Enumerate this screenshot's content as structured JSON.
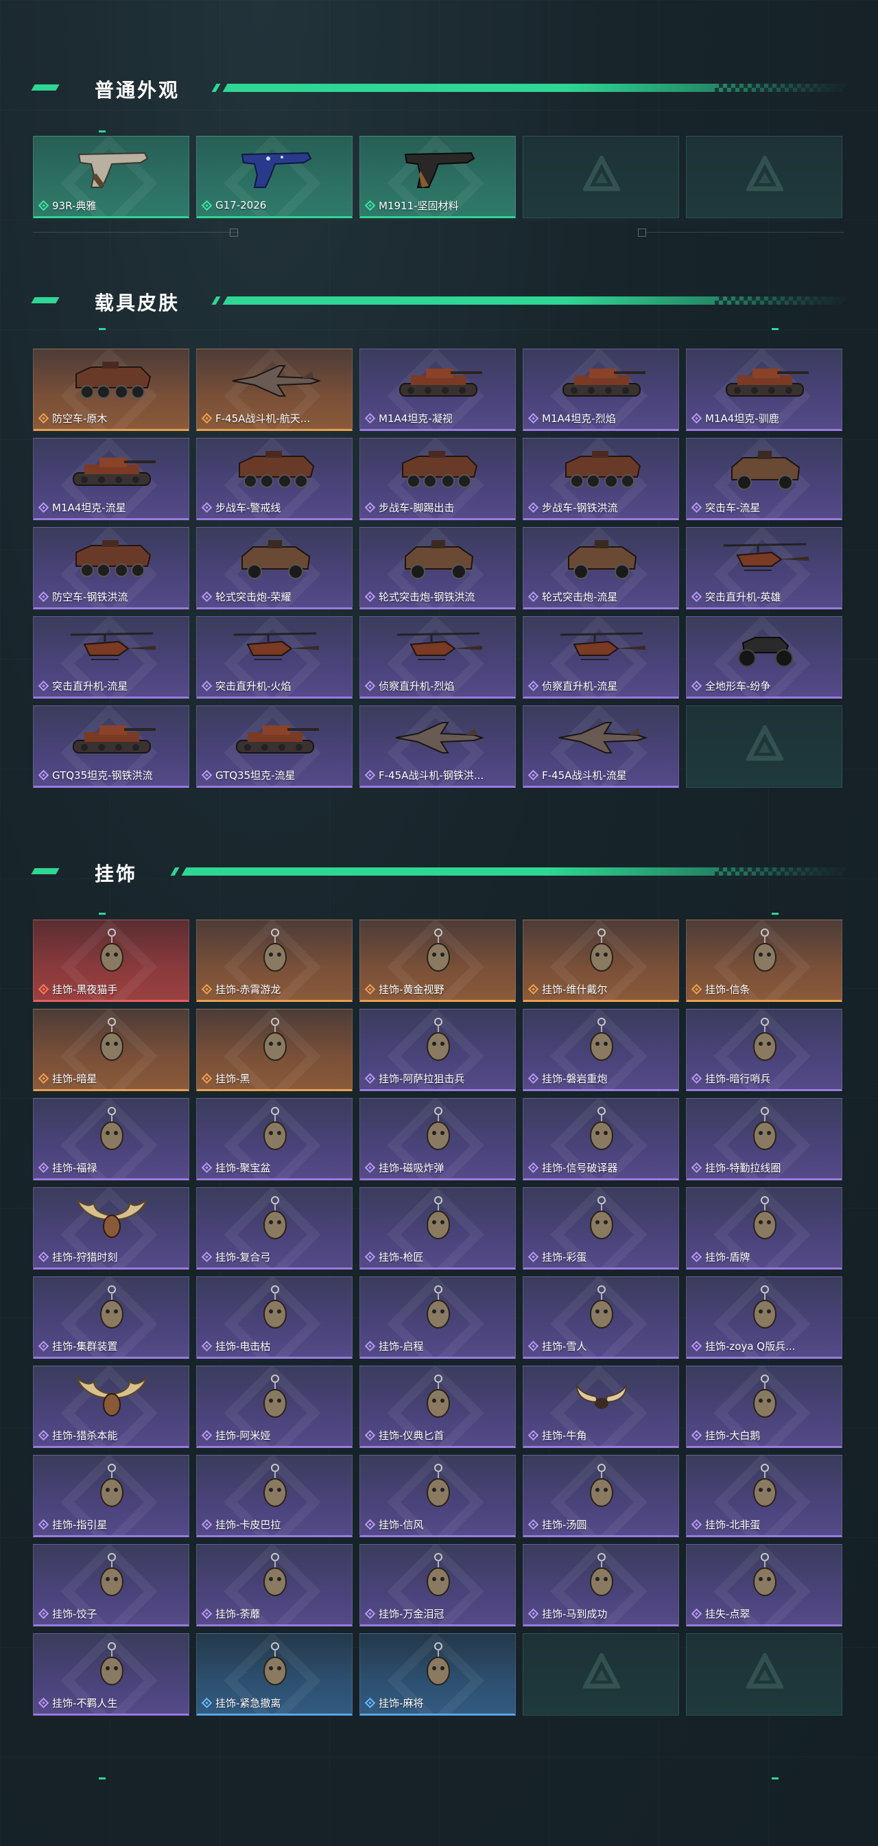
{
  "sections": [
    {
      "title": "普通外观",
      "cards": [
        {
          "name": "93R-典雅",
          "rarity": "green",
          "icon": "pistol"
        },
        {
          "name": "G17-2026",
          "rarity": "green",
          "icon": "pistol-blue"
        },
        {
          "name": "M1911-坚固材料",
          "rarity": "green",
          "icon": "pistol-dark"
        },
        {
          "name": "",
          "rarity": "empty",
          "icon": ""
        },
        {
          "name": "",
          "rarity": "empty",
          "icon": ""
        }
      ]
    },
    {
      "title": "载具皮肤",
      "cards": [
        {
          "name": "防空车-原木",
          "rarity": "orange",
          "icon": "wheeled-vehicle"
        },
        {
          "name": "F-45A战斗机-航天...",
          "rarity": "orange",
          "icon": "jet"
        },
        {
          "name": "M1A4坦克-凝视",
          "rarity": "purple",
          "icon": "tank"
        },
        {
          "name": "M1A4坦克-烈焰",
          "rarity": "purple",
          "icon": "tank"
        },
        {
          "name": "M1A4坦克-驯鹿",
          "rarity": "purple",
          "icon": "tank"
        },
        {
          "name": "M1A4坦克-流星",
          "rarity": "purple",
          "icon": "tank"
        },
        {
          "name": "步战车-警戒线",
          "rarity": "purple",
          "icon": "wheeled-vehicle"
        },
        {
          "name": "步战车-脚踢出击",
          "rarity": "purple",
          "icon": "wheeled-vehicle"
        },
        {
          "name": "步战车-钢铁洪流",
          "rarity": "purple",
          "icon": "wheeled-vehicle"
        },
        {
          "name": "突击车-流星",
          "rarity": "purple",
          "icon": "truck"
        },
        {
          "name": "防空车-钢铁洪流",
          "rarity": "purple",
          "icon": "wheeled-vehicle"
        },
        {
          "name": "轮式突击炮-荣耀",
          "rarity": "purple",
          "icon": "truck"
        },
        {
          "name": "轮式突击炮-钢铁洪流",
          "rarity": "purple",
          "icon": "truck"
        },
        {
          "name": "轮式突击炮-流星",
          "rarity": "purple",
          "icon": "truck"
        },
        {
          "name": "突击直升机-英雄",
          "rarity": "purple",
          "icon": "helicopter"
        },
        {
          "name": "突击直升机-流星",
          "rarity": "purple",
          "icon": "helicopter"
        },
        {
          "name": "突击直升机-火焰",
          "rarity": "purple",
          "icon": "helicopter"
        },
        {
          "name": "侦察直升机-烈焰",
          "rarity": "purple",
          "icon": "helicopter"
        },
        {
          "name": "侦察直升机-流星",
          "rarity": "purple",
          "icon": "helicopter"
        },
        {
          "name": "全地形车-纷争",
          "rarity": "purple",
          "icon": "atv"
        },
        {
          "name": "GTQ35坦克-钢铁洪流",
          "rarity": "purple",
          "icon": "tank"
        },
        {
          "name": "GTQ35坦克-流星",
          "rarity": "purple",
          "icon": "tank"
        },
        {
          "name": "F-45A战斗机-钢铁洪...",
          "rarity": "purple",
          "icon": "jet"
        },
        {
          "name": "F-45A战斗机-流星",
          "rarity": "purple",
          "icon": "jet"
        },
        {
          "name": "",
          "rarity": "empty",
          "icon": ""
        }
      ]
    },
    {
      "title": "挂饰",
      "cards": [
        {
          "name": "挂饰-黑夜猫手",
          "rarity": "red",
          "icon": "charm"
        },
        {
          "name": "挂饰-赤霄游龙",
          "rarity": "orange",
          "icon": "charm"
        },
        {
          "name": "挂饰-黄金视野",
          "rarity": "orange",
          "icon": "charm"
        },
        {
          "name": "挂饰-维什戴尔",
          "rarity": "orange",
          "icon": "charm"
        },
        {
          "name": "挂饰-信条",
          "rarity": "orange",
          "icon": "charm"
        },
        {
          "name": "挂饰-暗星",
          "rarity": "orange",
          "icon": "charm"
        },
        {
          "name": "挂饰-黑",
          "rarity": "orange",
          "icon": "charm"
        },
        {
          "name": "挂饰-阿萨拉狙击兵",
          "rarity": "purple",
          "icon": "charm"
        },
        {
          "name": "挂饰-磐岩重炮",
          "rarity": "purple",
          "icon": "charm"
        },
        {
          "name": "挂饰-暗行哨兵",
          "rarity": "purple",
          "icon": "charm"
        },
        {
          "name": "挂饰-福禄",
          "rarity": "purple",
          "icon": "charm"
        },
        {
          "name": "挂饰-聚宝盆",
          "rarity": "purple",
          "icon": "charm"
        },
        {
          "name": "挂饰-磁吸炸弹",
          "rarity": "purple",
          "icon": "charm"
        },
        {
          "name": "挂饰-信号破译器",
          "rarity": "purple",
          "icon": "charm"
        },
        {
          "name": "挂饰-特勤拉线圈",
          "rarity": "purple",
          "icon": "charm"
        },
        {
          "name": "挂饰-狩猎时刻",
          "rarity": "purple",
          "icon": "charm-antlers"
        },
        {
          "name": "挂饰-复合弓",
          "rarity": "purple",
          "icon": "charm"
        },
        {
          "name": "挂饰-枪匠",
          "rarity": "purple",
          "icon": "charm"
        },
        {
          "name": "挂饰-彩蛋",
          "rarity": "purple",
          "icon": "charm"
        },
        {
          "name": "挂饰-盾牌",
          "rarity": "purple",
          "icon": "charm"
        },
        {
          "name": "挂饰-集群装置",
          "rarity": "purple",
          "icon": "charm"
        },
        {
          "name": "挂饰-电击枯",
          "rarity": "purple",
          "icon": "charm"
        },
        {
          "name": "挂饰-启程",
          "rarity": "purple",
          "icon": "charm"
        },
        {
          "name": "挂饰-雪人",
          "rarity": "purple",
          "icon": "charm"
        },
        {
          "name": "挂饰-zoya Q版兵...",
          "rarity": "purple",
          "icon": "charm"
        },
        {
          "name": "挂饰-猎杀本能",
          "rarity": "purple",
          "icon": "charm-antlers"
        },
        {
          "name": "挂饰-阿米娅",
          "rarity": "purple",
          "icon": "charm"
        },
        {
          "name": "挂饰-仪典匕首",
          "rarity": "purple",
          "icon": "charm"
        },
        {
          "name": "挂饰-牛角",
          "rarity": "purple",
          "icon": "charm-horns"
        },
        {
          "name": "挂饰-大白鹅",
          "rarity": "purple",
          "icon": "charm"
        },
        {
          "name": "挂饰-指引星",
          "rarity": "purple",
          "icon": "charm"
        },
        {
          "name": "挂饰-卡皮巴拉",
          "rarity": "purple",
          "icon": "charm"
        },
        {
          "name": "挂饰-信风",
          "rarity": "purple",
          "icon": "charm"
        },
        {
          "name": "挂饰-汤圆",
          "rarity": "purple",
          "icon": "charm"
        },
        {
          "name": "挂饰-北非蛋",
          "rarity": "purple",
          "icon": "charm"
        },
        {
          "name": "挂饰-饺子",
          "rarity": "purple",
          "icon": "charm"
        },
        {
          "name": "挂饰-荼蘼",
          "rarity": "purple",
          "icon": "charm"
        },
        {
          "name": "挂饰-万金泪冠",
          "rarity": "purple",
          "icon": "charm"
        },
        {
          "name": "挂饰-马到成功",
          "rarity": "purple",
          "icon": "charm"
        },
        {
          "name": "挂失-点翠",
          "rarity": "purple",
          "icon": "charm"
        },
        {
          "name": "挂饰-不羁人生",
          "rarity": "purple",
          "icon": "charm"
        },
        {
          "name": "挂饰-紧急撤离",
          "rarity": "blue",
          "icon": "charm"
        },
        {
          "name": "挂饰-麻将",
          "rarity": "blue",
          "icon": "charm"
        },
        {
          "name": "",
          "rarity": "empty",
          "icon": ""
        },
        {
          "name": "",
          "rarity": "empty",
          "icon": ""
        }
      ]
    }
  ]
}
